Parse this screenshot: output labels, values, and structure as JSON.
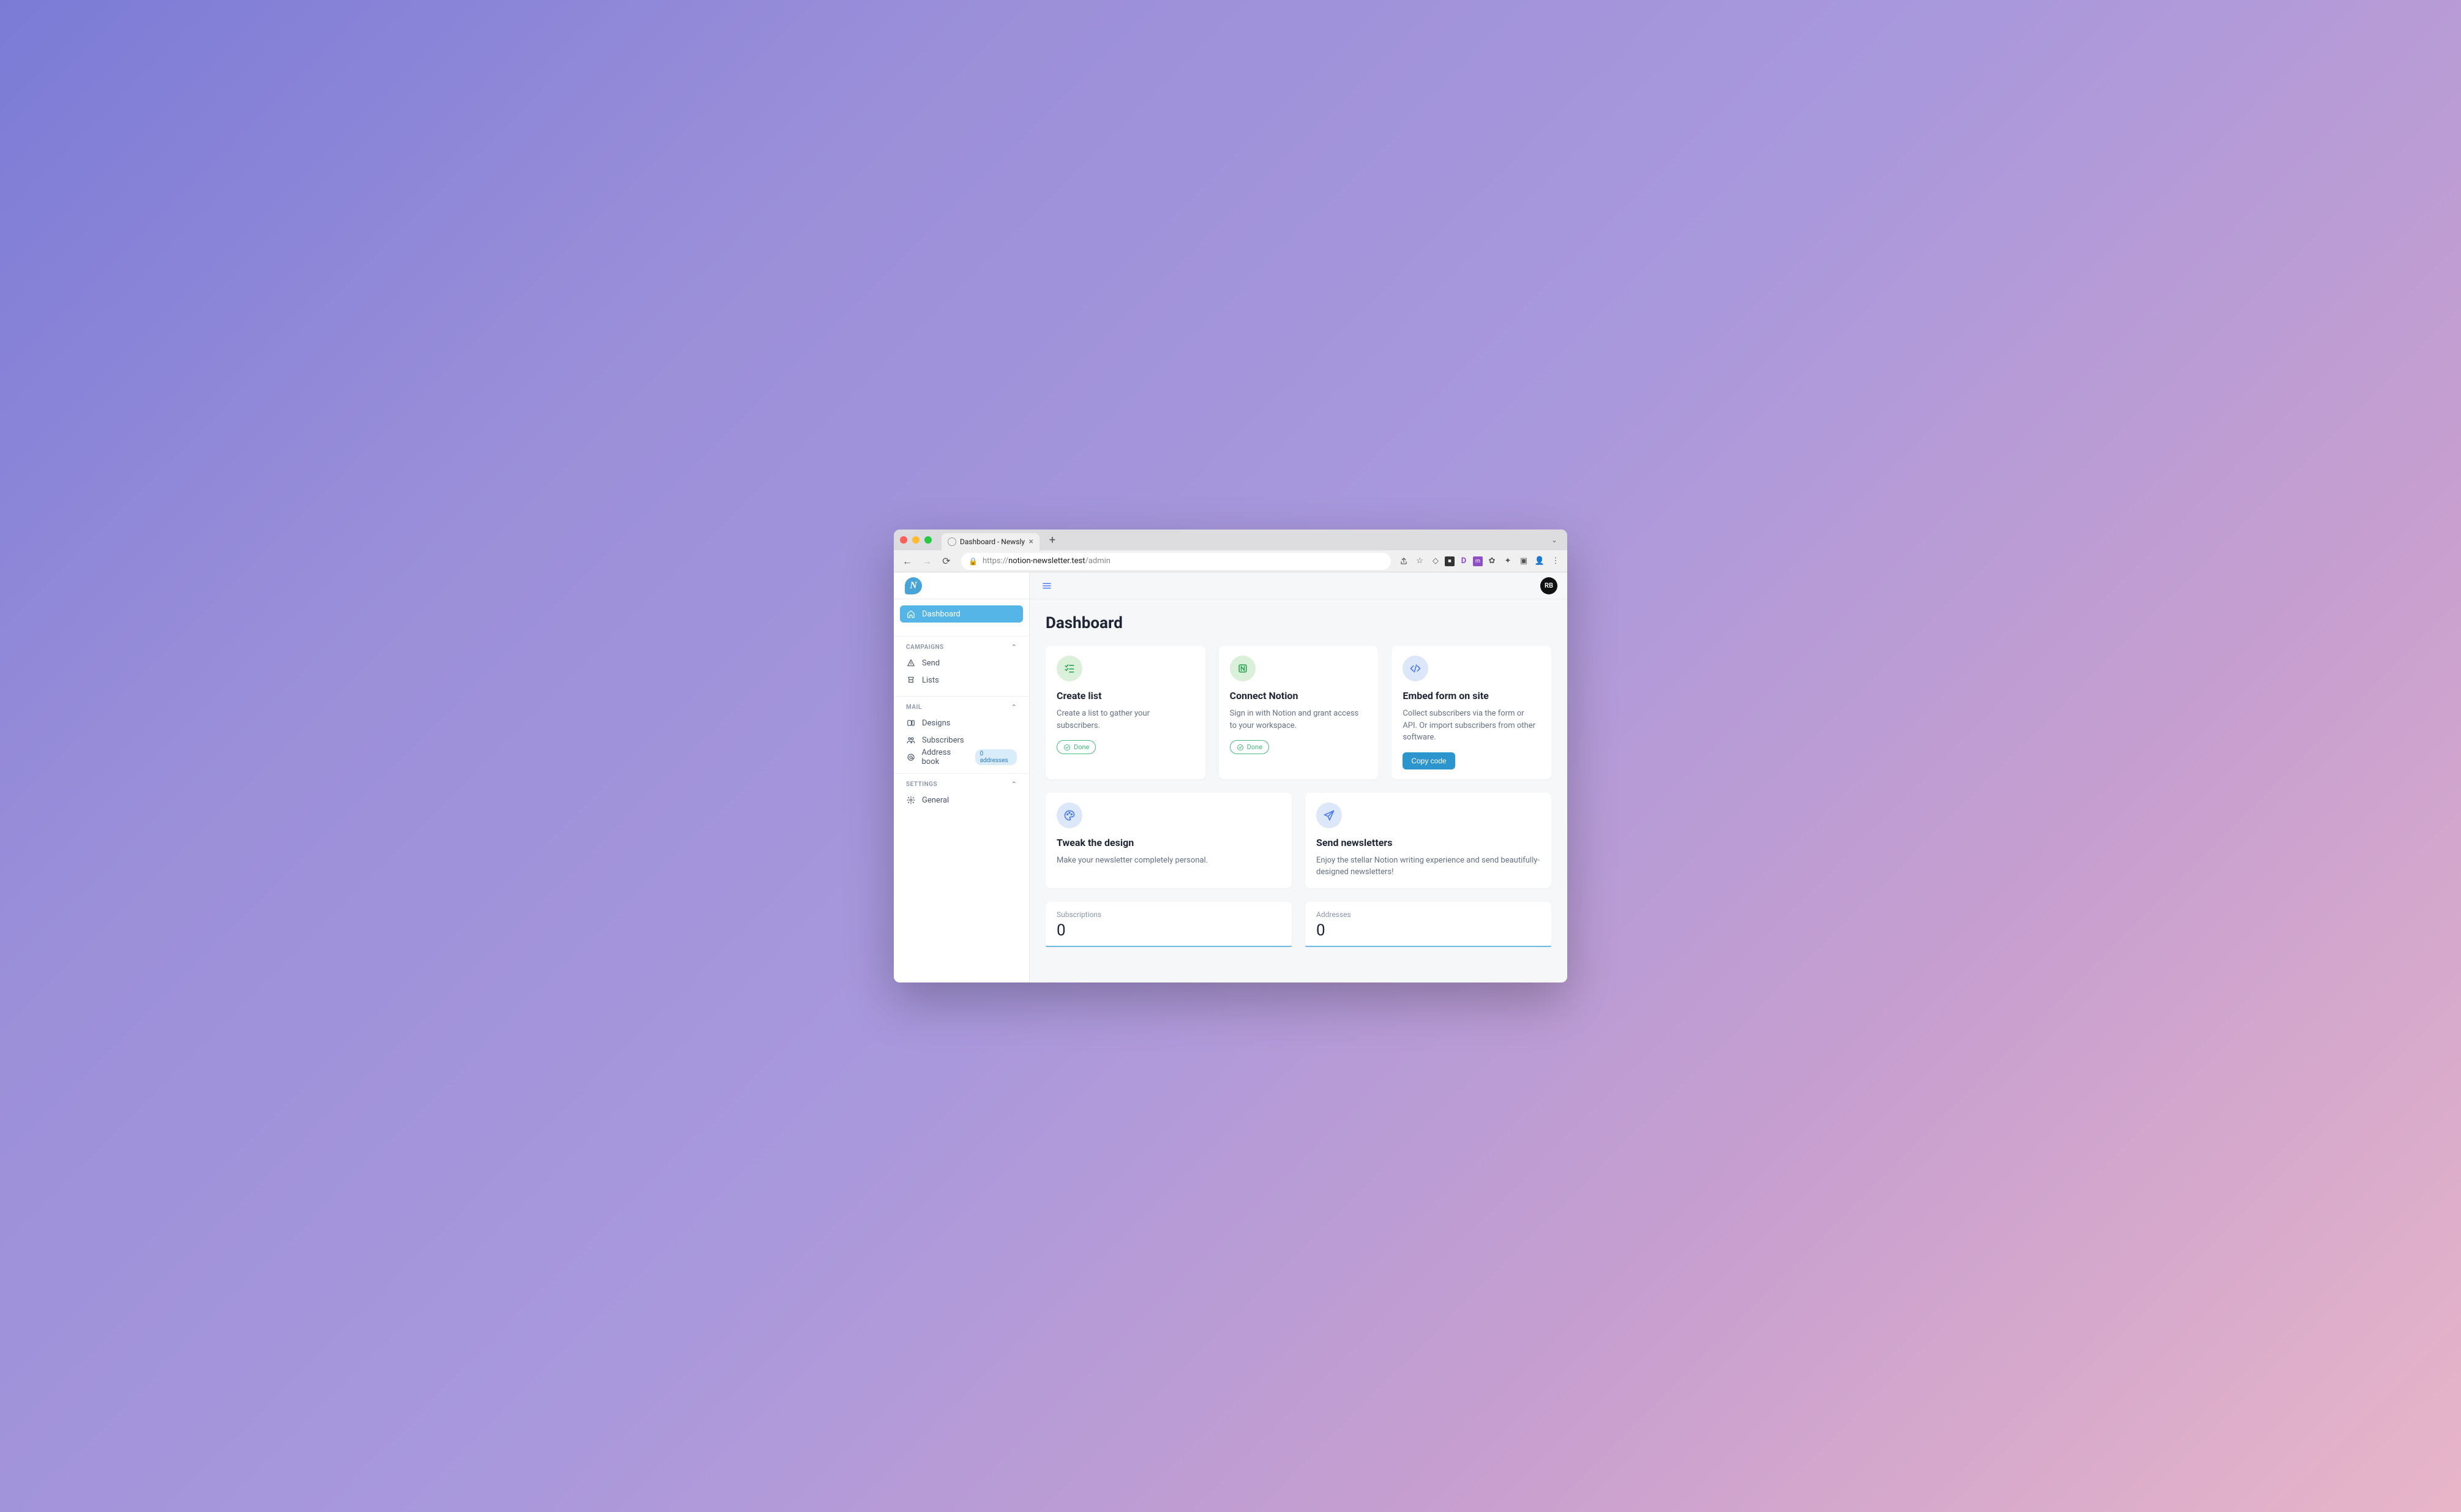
{
  "browser": {
    "tab_title": "Dashboard - Newsly",
    "url_scheme": "https://",
    "url_host": "notion-newsletter.test",
    "url_path": "/admin"
  },
  "header": {
    "avatar_initials": "RB"
  },
  "sidebar": {
    "logo_letter": "N",
    "dashboard_label": "Dashboard",
    "sections": {
      "campaigns": {
        "title": "CAMPAIGNS",
        "items": {
          "send": "Send",
          "lists": "Lists"
        }
      },
      "mail": {
        "title": "MAIL",
        "items": {
          "designs": "Designs",
          "subscribers": "Subscribers",
          "addressbook": "Address book"
        },
        "addressbook_badge": "0 addresses"
      },
      "settings": {
        "title": "SETTINGS",
        "items": {
          "general": "General"
        }
      }
    }
  },
  "page": {
    "title": "Dashboard"
  },
  "onboarding": {
    "create_list": {
      "title": "Create list",
      "desc": "Create a list to gather your subscribers.",
      "status": "Done"
    },
    "connect_notion": {
      "title": "Connect Notion",
      "desc": "Sign in with Notion and grant access to your workspace.",
      "status": "Done"
    },
    "embed_form": {
      "title": "Embed form on site",
      "desc": "Collect subscribers via the form or API. Or import subscribers from other software.",
      "button": "Copy code"
    },
    "tweak_design": {
      "title": "Tweak the design",
      "desc": "Make your newsletter completely personal."
    },
    "send_newsletters": {
      "title": "Send newsletters",
      "desc": "Enjoy the stellar Notion writing experience and send beautifully-designed newsletters!"
    }
  },
  "stats": {
    "subscriptions": {
      "label": "Subscriptions",
      "value": "0"
    },
    "addresses": {
      "label": "Addresses",
      "value": "0"
    }
  },
  "colors": {
    "accent": "#55B5E6",
    "success": "#45BB7E",
    "primary_btn": "#2D95CE",
    "icon_blue": "#4F7CF0"
  }
}
